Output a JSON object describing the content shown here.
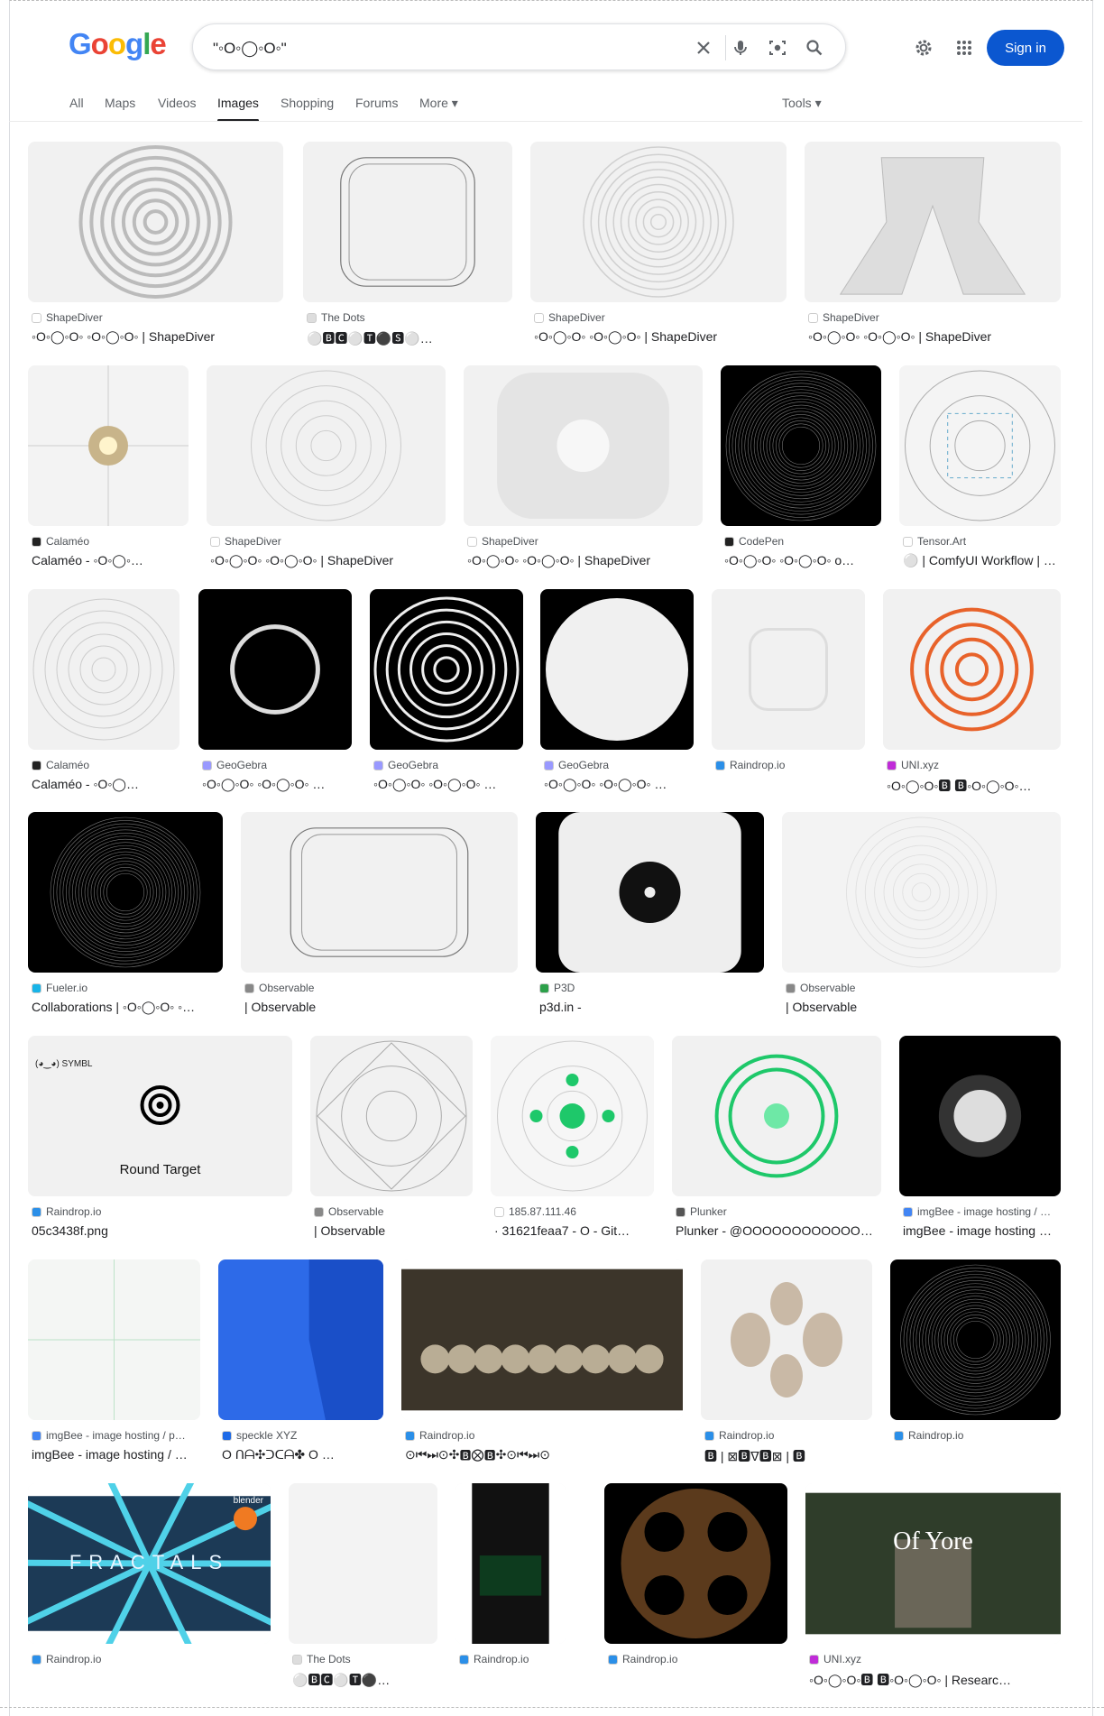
{
  "header": {
    "logo_letters": [
      "G",
      "o",
      "o",
      "g",
      "l",
      "e"
    ],
    "query": "\"◦O◦◯◦O◦\"",
    "sign_in": "Sign in"
  },
  "tabs": [
    {
      "label": "All"
    },
    {
      "label": "Maps"
    },
    {
      "label": "Videos"
    },
    {
      "label": "Images"
    },
    {
      "label": "Shopping"
    },
    {
      "label": "Forums"
    },
    {
      "label": "More ▾"
    }
  ],
  "tools": "Tools ▾",
  "results": [
    {
      "src": "ShapeDiver",
      "title": "◦O◦◯◦O◦  ◦O◦◯◦O◦ | ShapeDiver"
    },
    {
      "src": "The Dots",
      "title": "⚪🅱🅲⚪🆃⚫🆂⚪…"
    },
    {
      "src": "ShapeDiver",
      "title": "◦O◦◯◦O◦  ◦O◦◯◦O◦ | ShapeDiver"
    },
    {
      "src": "ShapeDiver",
      "title": "◦O◦◯◦O◦  ◦O◦◯◦O◦ | ShapeDiver"
    },
    {
      "src": "Calaméo",
      "title": "Calaméo -   ◦O◦◯◦…"
    },
    {
      "src": "ShapeDiver",
      "title": "◦O◦◯◦O◦  ◦O◦◯◦O◦ | ShapeDiver"
    },
    {
      "src": "ShapeDiver",
      "title": "◦O◦◯◦O◦  ◦O◦◯◦O◦ | ShapeDiver"
    },
    {
      "src": "CodePen",
      "title": "◦O◦◯◦O◦  ◦O◦◯◦O◦ o…"
    },
    {
      "src": "Tensor.Art",
      "title": "⚪ | ComfyUI Workflow | …"
    },
    {
      "src": "Calaméo",
      "title": "Calaméo -   ◦O◦◯…"
    },
    {
      "src": "GeoGebra",
      "title": "◦O◦◯◦O◦  ◦O◦◯◦O◦ …"
    },
    {
      "src": "GeoGebra",
      "title": "◦O◦◯◦O◦  ◦O◦◯◦O◦ …"
    },
    {
      "src": "GeoGebra",
      "title": "◦O◦◯◦O◦  ◦O◦◯◦O◦ …"
    },
    {
      "src": "Raindrop.io",
      "title": ""
    },
    {
      "src": "UNI.xyz",
      "title": "◦O◦◯◦O◦🅱  🅱◦O◦◯◦O◦…"
    },
    {
      "src": "Fueler.io",
      "title": "Collaborations | ◦O◦◯◦O◦  ◦…"
    },
    {
      "src": "Observable",
      "title": "  | Observable"
    },
    {
      "src": "P3D",
      "title": "p3d.in -"
    },
    {
      "src": "Observable",
      "title": "  | Observable"
    },
    {
      "src": "Raindrop.io",
      "title": "05c3438f.png",
      "thumb_text": "Round Target",
      "thumb_corner": "(◕‿◕) SYMBL"
    },
    {
      "src": "Observable",
      "title": "  | Observable"
    },
    {
      "src": "185.87.111.46",
      "title": "· 31621feaa7 - O - Git…"
    },
    {
      "src": "Plunker",
      "title": "Plunker - @OOOOOOOOOOOOO…"
    },
    {
      "src": "imgBee - image hosting / …",
      "title": "imgBee - image hosting …"
    },
    {
      "src": "imgBee - image hosting / p…",
      "title": "imgBee - image hosting / …"
    },
    {
      "src": "speckle XYZ",
      "title": "O  ᑎᗩ✣ᑐᑕᗩ✤  O  …"
    },
    {
      "src": "Raindrop.io",
      "title": "⊙⏮⏭⊙✣🅱⨂🅱✣⊙⏮⏭⊙"
    },
    {
      "src": "Raindrop.io",
      "title": "🅱 | ⊠🅱ᐁ🅱⊠ | 🅱"
    },
    {
      "src": "Raindrop.io",
      "title": ""
    },
    {
      "src": "Raindrop.io",
      "title": "",
      "thumb_text": "FRACTALS",
      "thumb_corner": "blender"
    },
    {
      "src": "The Dots",
      "title": "⚪🅱🅲⚪🆃⚫…"
    },
    {
      "src": "Raindrop.io",
      "title": ""
    },
    {
      "src": "Raindrop.io",
      "title": ""
    },
    {
      "src": "UNI.xyz",
      "title": "◦O◦◯◦O◦🅱  🅱◦O◦◯◦O◦ | Researc…",
      "thumb_text": "Of Yore"
    }
  ],
  "colors": {
    "accent": "#0b57d0",
    "orange": "#e8622a",
    "green": "#1ec86a"
  }
}
